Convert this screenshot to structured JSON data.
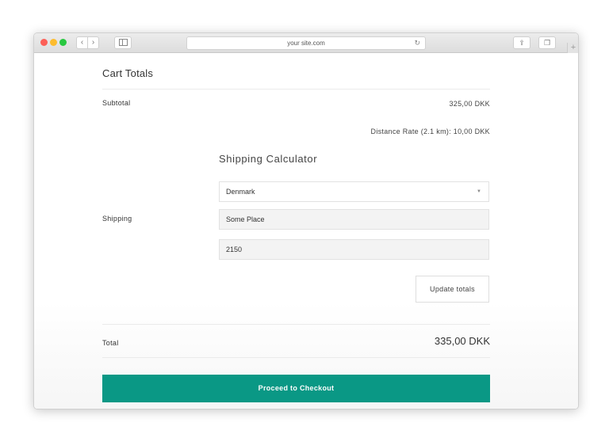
{
  "browser": {
    "address": "your site.com",
    "reload_glyph": "↻",
    "back_glyph": "‹",
    "forward_glyph": "›",
    "share_glyph": "⇪",
    "tabs_glyph": "❐",
    "plus_glyph": "+"
  },
  "cart": {
    "title": "Cart Totals",
    "subtotal_label": "Subtotal",
    "subtotal_value": "325,00 DKK",
    "shipping_label": "Shipping",
    "shipping_rate": "Distance Rate (2.1 km): 10,00 DKK",
    "total_label": "Total",
    "total_value": "335,00 DKK",
    "checkout_label": "Proceed to Checkout"
  },
  "shipping_calculator": {
    "title": "Shipping Calculator",
    "country": "Denmark",
    "city": "Some Place",
    "postcode": "2150",
    "update_label": "Update totals",
    "select_arrow": "▼"
  },
  "colors": {
    "checkout_button": "#0a9885",
    "close": "#fc5f57",
    "minimize": "#fdbc2e",
    "maximize": "#28c840"
  },
  "icons": [
    "close-icon",
    "minimize-icon",
    "maximize-icon",
    "back-icon",
    "forward-icon",
    "sidebar-icon",
    "reload-icon",
    "share-icon",
    "tabs-icon",
    "new-tab-icon",
    "dropdown-arrow-icon"
  ]
}
